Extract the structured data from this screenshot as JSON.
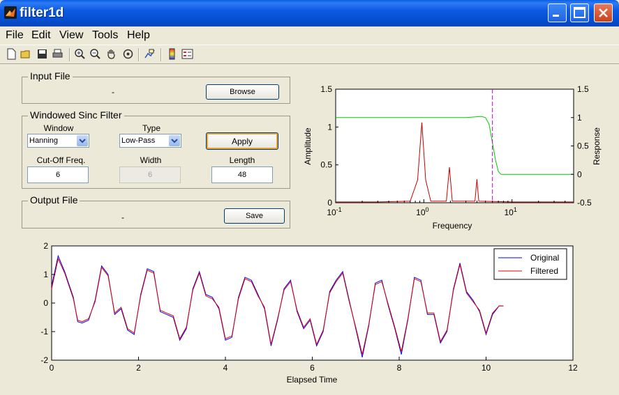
{
  "window": {
    "title": "filter1d"
  },
  "menu": [
    "File",
    "Edit",
    "View",
    "Tools",
    "Help"
  ],
  "toolbar_icons": [
    "new-file-icon",
    "open-file-icon",
    "save-icon",
    "print-icon",
    "zoom-in-icon",
    "zoom-out-icon",
    "pan-icon",
    "rotate-icon",
    "data-cursor-icon",
    "colorbar-icon",
    "legend-icon"
  ],
  "input_file": {
    "title": "Input File",
    "filename": "-",
    "browse_label": "Browse"
  },
  "filter": {
    "title": "Windowed Sinc Filter",
    "window_label": "Window",
    "window_value": "Hanning",
    "type_label": "Type",
    "type_value": "Low-Pass",
    "apply_label": "Apply",
    "cutoff_label": "Cut-Off Freq.",
    "cutoff_value": "6",
    "width_label": "Width",
    "width_value": "6",
    "length_label": "Length",
    "length_value": "48"
  },
  "output_file": {
    "title": "Output File",
    "filename": "-",
    "save_label": "Save"
  },
  "colors": {
    "original": "#0000FF",
    "filtered": "#DD0000",
    "response": "#00CC00",
    "cutoff_marker": "#CC00CC",
    "amplitude": "#CC0000"
  },
  "chart_data": [
    {
      "type": "line",
      "xlabel": "Frequency",
      "ylabel": "Amplitude",
      "y2label": "Response",
      "xscale": "log",
      "xlim": [
        0.1,
        50
      ],
      "ylim": [
        0,
        1.5
      ],
      "y2lim": [
        -0.5,
        1.5
      ],
      "x_tick_labels": [
        "10-1",
        "100",
        "101"
      ],
      "y_tick_labels": [
        "0",
        "0.5",
        "1",
        "1.5"
      ],
      "y2_tick_labels": [
        "-0.5",
        "0",
        "0.5",
        "1",
        "1.5"
      ],
      "cutoff": 6,
      "series": [
        {
          "axis": "left",
          "color": "#CC0000",
          "points": [
            [
              0.1,
              0.01
            ],
            [
              0.3,
              0.01
            ],
            [
              0.7,
              0.02
            ],
            [
              0.85,
              0.3
            ],
            [
              0.95,
              1.06
            ],
            [
              1.05,
              0.3
            ],
            [
              1.2,
              0.02
            ],
            [
              1.8,
              0.02
            ],
            [
              1.95,
              0.47
            ],
            [
              2.1,
              0.02
            ],
            [
              3.8,
              0.02
            ],
            [
              4.0,
              0.31
            ],
            [
              4.2,
              0.02
            ],
            [
              10,
              0.01
            ],
            [
              50,
              0.01
            ]
          ]
        },
        {
          "axis": "right",
          "color": "#00CC00",
          "points": [
            [
              0.1,
              1.0
            ],
            [
              3.0,
              1.0
            ],
            [
              4.5,
              1.02
            ],
            [
              5.0,
              1.0
            ],
            [
              5.5,
              0.88
            ],
            [
              6.0,
              0.55
            ],
            [
              6.5,
              0.25
            ],
            [
              7.0,
              0.05
            ],
            [
              7.5,
              0.0
            ],
            [
              10,
              0.0
            ],
            [
              20,
              0.0
            ],
            [
              50,
              0.0
            ]
          ]
        }
      ]
    },
    {
      "type": "line",
      "xlabel": "Elapsed Time",
      "xlim": [
        0,
        12
      ],
      "ylim": [
        -2,
        2
      ],
      "x_tick_labels": [
        "0",
        "2",
        "4",
        "6",
        "8",
        "10",
        "12"
      ],
      "y_tick_labels": [
        "-2",
        "-1",
        "0",
        "1",
        "2"
      ],
      "legend": "top-right",
      "series": [
        {
          "name": "Original",
          "color": "#0000FF",
          "points": [
            [
              0,
              0.6
            ],
            [
              0.15,
              1.65
            ],
            [
              0.3,
              1.1
            ],
            [
              0.5,
              0.2
            ],
            [
              0.6,
              -0.65
            ],
            [
              0.7,
              -0.7
            ],
            [
              0.85,
              -0.6
            ],
            [
              1.0,
              0.1
            ],
            [
              1.15,
              1.3
            ],
            [
              1.3,
              1.0
            ],
            [
              1.45,
              -0.4
            ],
            [
              1.6,
              -0.2
            ],
            [
              1.75,
              -0.95
            ],
            [
              1.9,
              -1.1
            ],
            [
              2.05,
              0.3
            ],
            [
              2.2,
              1.2
            ],
            [
              2.35,
              1.1
            ],
            [
              2.5,
              -0.3
            ],
            [
              2.65,
              -0.4
            ],
            [
              2.8,
              -0.5
            ],
            [
              2.95,
              -1.3
            ],
            [
              3.1,
              -0.9
            ],
            [
              3.25,
              0.5
            ],
            [
              3.4,
              1.1
            ],
            [
              3.55,
              0.3
            ],
            [
              3.7,
              0.2
            ],
            [
              3.85,
              -0.2
            ],
            [
              4.0,
              -1.3
            ],
            [
              4.15,
              -1.2
            ],
            [
              4.3,
              0.2
            ],
            [
              4.45,
              0.9
            ],
            [
              4.6,
              0.8
            ],
            [
              4.75,
              0.3
            ],
            [
              4.9,
              -0.2
            ],
            [
              5.05,
              -1.5
            ],
            [
              5.2,
              -0.6
            ],
            [
              5.35,
              0.5
            ],
            [
              5.5,
              0.8
            ],
            [
              5.65,
              -0.3
            ],
            [
              5.8,
              -0.9
            ],
            [
              5.95,
              -0.6
            ],
            [
              6.1,
              -1.5
            ],
            [
              6.25,
              -1.0
            ],
            [
              6.4,
              0.4
            ],
            [
              6.55,
              0.8
            ],
            [
              6.7,
              1.1
            ],
            [
              6.85,
              0.1
            ],
            [
              7.0,
              -0.9
            ],
            [
              7.15,
              -1.9
            ],
            [
              7.3,
              -0.8
            ],
            [
              7.45,
              0.7
            ],
            [
              7.6,
              0.8
            ],
            [
              7.75,
              -0.1
            ],
            [
              7.9,
              -0.9
            ],
            [
              8.05,
              -1.8
            ],
            [
              8.2,
              -0.6
            ],
            [
              8.35,
              0.9
            ],
            [
              8.5,
              0.8
            ],
            [
              8.65,
              -0.4
            ],
            [
              8.8,
              -0.4
            ],
            [
              8.95,
              -1.4
            ],
            [
              9.1,
              -1.0
            ],
            [
              9.25,
              0.5
            ],
            [
              9.4,
              1.4
            ],
            [
              9.55,
              0.4
            ],
            [
              9.7,
              0.1
            ],
            [
              9.85,
              -0.3
            ],
            [
              10.0,
              -1.1
            ],
            [
              10.15,
              -0.4
            ],
            [
              10.3,
              -0.1
            ],
            [
              10.4,
              -0.1
            ]
          ]
        },
        {
          "name": "Filtered",
          "color": "#DD0000",
          "points": [
            [
              0,
              0.5
            ],
            [
              0.15,
              1.55
            ],
            [
              0.3,
              1.05
            ],
            [
              0.5,
              0.15
            ],
            [
              0.6,
              -0.6
            ],
            [
              0.7,
              -0.65
            ],
            [
              0.85,
              -0.55
            ],
            [
              1.0,
              0.05
            ],
            [
              1.15,
              1.25
            ],
            [
              1.3,
              0.95
            ],
            [
              1.45,
              -0.35
            ],
            [
              1.6,
              -0.15
            ],
            [
              1.75,
              -0.9
            ],
            [
              1.9,
              -1.05
            ],
            [
              2.05,
              0.25
            ],
            [
              2.2,
              1.15
            ],
            [
              2.35,
              1.05
            ],
            [
              2.5,
              -0.25
            ],
            [
              2.65,
              -0.35
            ],
            [
              2.8,
              -0.45
            ],
            [
              2.95,
              -1.25
            ],
            [
              3.1,
              -0.85
            ],
            [
              3.25,
              0.45
            ],
            [
              3.4,
              1.05
            ],
            [
              3.55,
              0.25
            ],
            [
              3.7,
              0.15
            ],
            [
              3.85,
              -0.15
            ],
            [
              4.0,
              -1.25
            ],
            [
              4.15,
              -1.15
            ],
            [
              4.3,
              0.15
            ],
            [
              4.45,
              0.85
            ],
            [
              4.6,
              0.75
            ],
            [
              4.75,
              0.25
            ],
            [
              4.9,
              -0.15
            ],
            [
              5.05,
              -1.45
            ],
            [
              5.2,
              -0.55
            ],
            [
              5.35,
              0.45
            ],
            [
              5.5,
              0.75
            ],
            [
              5.65,
              -0.25
            ],
            [
              5.8,
              -0.85
            ],
            [
              5.95,
              -0.55
            ],
            [
              6.1,
              -1.45
            ],
            [
              6.25,
              -0.95
            ],
            [
              6.4,
              0.35
            ],
            [
              6.55,
              0.75
            ],
            [
              6.7,
              1.05
            ],
            [
              6.85,
              0.05
            ],
            [
              7.0,
              -0.85
            ],
            [
              7.15,
              -1.8
            ],
            [
              7.3,
              -0.75
            ],
            [
              7.45,
              0.65
            ],
            [
              7.6,
              0.75
            ],
            [
              7.75,
              -0.05
            ],
            [
              7.9,
              -0.85
            ],
            [
              8.05,
              -1.7
            ],
            [
              8.2,
              -0.55
            ],
            [
              8.35,
              0.85
            ],
            [
              8.5,
              0.75
            ],
            [
              8.65,
              -0.35
            ],
            [
              8.8,
              -0.35
            ],
            [
              8.95,
              -1.35
            ],
            [
              9.1,
              -0.95
            ],
            [
              9.25,
              0.45
            ],
            [
              9.4,
              1.35
            ],
            [
              9.55,
              0.35
            ],
            [
              9.7,
              0.05
            ],
            [
              9.85,
              -0.25
            ],
            [
              10.0,
              -1.05
            ],
            [
              10.15,
              -0.35
            ],
            [
              10.3,
              -0.1
            ],
            [
              10.4,
              -0.1
            ]
          ]
        }
      ]
    }
  ]
}
